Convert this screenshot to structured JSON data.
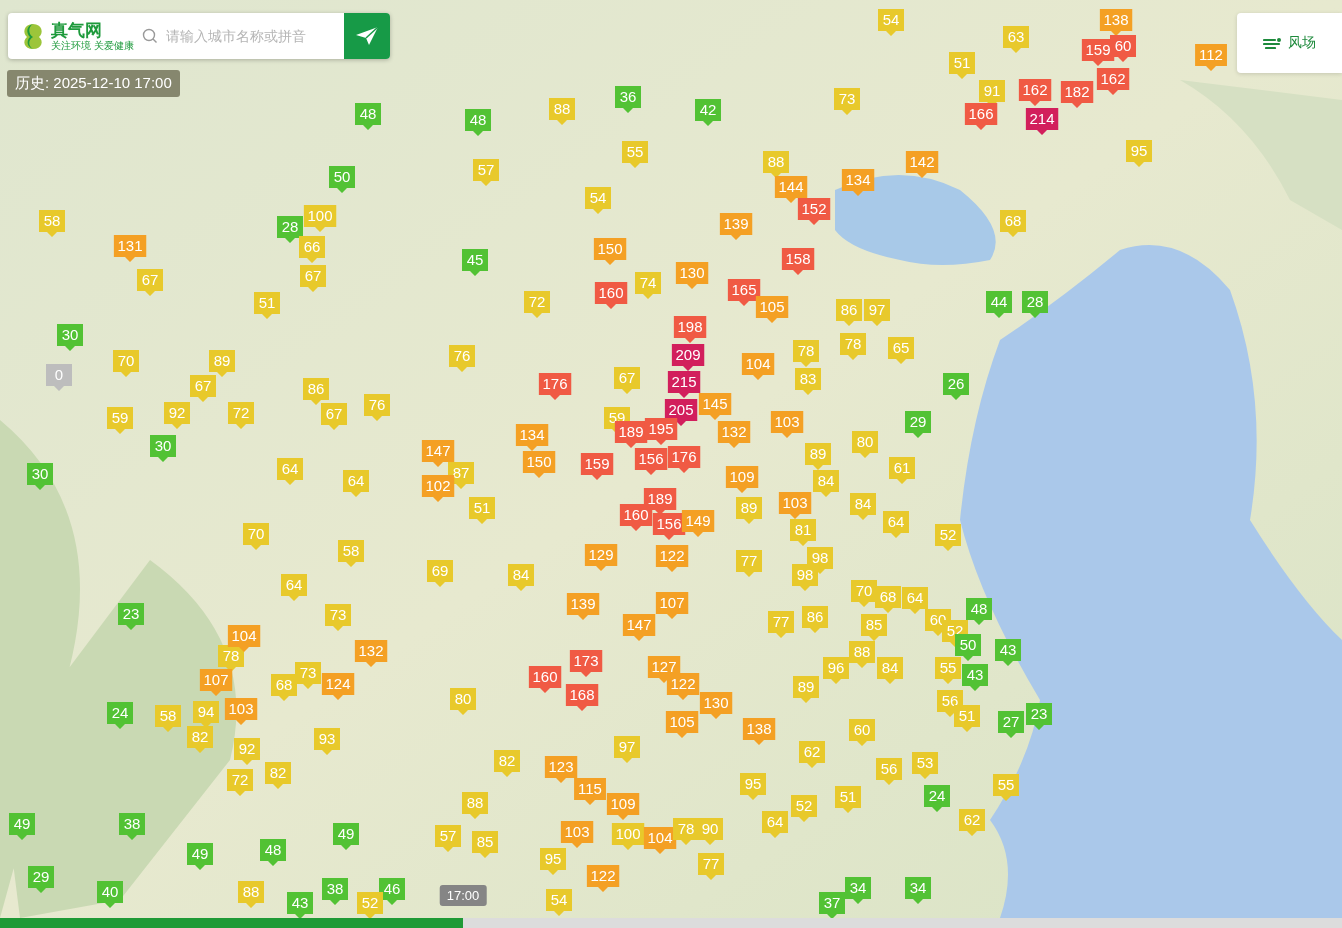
{
  "search": {
    "logo_title": "真气网",
    "logo_tagline": "关注环境 关爱健康",
    "placeholder": "请输入城市名称或拼音"
  },
  "history_badge": "历史: 2025-12-10 17:00",
  "wind_button": "风场",
  "markers": [
    {
      "value": "54",
      "color": "#e8c92b"
    },
    {
      "value": "138",
      "color": "#f4a024"
    },
    {
      "value": "63",
      "color": "#e8c92b"
    },
    {
      "value": "159",
      "color": "#f05a44"
    },
    {
      "value": "60",
      "color": "#f05a44"
    },
    {
      "value": "112",
      "color": "#f4a024"
    },
    {
      "value": "51",
      "color": "#e8c92b"
    },
    {
      "value": "162",
      "color": "#f05a44"
    },
    {
      "value": "48",
      "color": "#52c234"
    },
    {
      "value": "88",
      "color": "#e8c92b"
    },
    {
      "value": "36",
      "color": "#52c234"
    },
    {
      "value": "42",
      "color": "#52c234"
    },
    {
      "value": "73",
      "color": "#e8c92b"
    },
    {
      "value": "91",
      "color": "#e8c92b"
    },
    {
      "value": "166",
      "color": "#f05a44"
    },
    {
      "value": "162",
      "color": "#f05a44"
    },
    {
      "value": "214",
      "color": "#d21f5c"
    },
    {
      "value": "182",
      "color": "#f05a44"
    },
    {
      "value": "48",
      "color": "#52c234"
    },
    {
      "value": "50",
      "color": "#52c234"
    },
    {
      "value": "57",
      "color": "#e8c92b"
    },
    {
      "value": "55",
      "color": "#e8c92b"
    },
    {
      "value": "88",
      "color": "#e8c92b"
    },
    {
      "value": "142",
      "color": "#f4a024"
    },
    {
      "value": "95",
      "color": "#e8c92b"
    },
    {
      "value": "54",
      "color": "#e8c92b"
    },
    {
      "value": "144",
      "color": "#f4a024"
    },
    {
      "value": "152",
      "color": "#f05a44"
    },
    {
      "value": "134",
      "color": "#f4a024"
    },
    {
      "value": "58",
      "color": "#e8c92b"
    },
    {
      "value": "28",
      "color": "#52c234"
    },
    {
      "value": "100",
      "color": "#e8c92b"
    },
    {
      "value": "139",
      "color": "#f4a024"
    },
    {
      "value": "68",
      "color": "#e8c92b"
    },
    {
      "value": "131",
      "color": "#f4a024"
    },
    {
      "value": "66",
      "color": "#e8c92b"
    },
    {
      "value": "45",
      "color": "#52c234"
    },
    {
      "value": "150",
      "color": "#f4a024"
    },
    {
      "value": "158",
      "color": "#f05a44"
    },
    {
      "value": "67",
      "color": "#e8c92b"
    },
    {
      "value": "67",
      "color": "#e8c92b"
    },
    {
      "value": "160",
      "color": "#f05a44"
    },
    {
      "value": "74",
      "color": "#e8c92b"
    },
    {
      "value": "130",
      "color": "#f4a024"
    },
    {
      "value": "165",
      "color": "#f05a44"
    },
    {
      "value": "51",
      "color": "#e8c92b"
    },
    {
      "value": "72",
      "color": "#e8c92b"
    },
    {
      "value": "198",
      "color": "#f05a44"
    },
    {
      "value": "105",
      "color": "#f4a024"
    },
    {
      "value": "86",
      "color": "#e8c92b"
    },
    {
      "value": "97",
      "color": "#e8c92b"
    },
    {
      "value": "44",
      "color": "#52c234"
    },
    {
      "value": "28",
      "color": "#52c234"
    },
    {
      "value": "30",
      "color": "#52c234"
    },
    {
      "value": "76",
      "color": "#e8c92b"
    },
    {
      "value": "209",
      "color": "#d21f5c"
    },
    {
      "value": "78",
      "color": "#e8c92b"
    },
    {
      "value": "78",
      "color": "#e8c92b"
    },
    {
      "value": "65",
      "color": "#e8c92b"
    },
    {
      "value": "0",
      "color": "#bdbdbd"
    },
    {
      "value": "70",
      "color": "#e8c92b"
    },
    {
      "value": "67",
      "color": "#e8c92b"
    },
    {
      "value": "89",
      "color": "#e8c92b"
    },
    {
      "value": "86",
      "color": "#e8c92b"
    },
    {
      "value": "176",
      "color": "#f05a44"
    },
    {
      "value": "67",
      "color": "#e8c92b"
    },
    {
      "value": "215",
      "color": "#d21f5c"
    },
    {
      "value": "104",
      "color": "#f4a024"
    },
    {
      "value": "83",
      "color": "#e8c92b"
    },
    {
      "value": "26",
      "color": "#52c234"
    },
    {
      "value": "59",
      "color": "#e8c92b"
    },
    {
      "value": "92",
      "color": "#e8c92b"
    },
    {
      "value": "72",
      "color": "#e8c92b"
    },
    {
      "value": "67",
      "color": "#e8c92b"
    },
    {
      "value": "76",
      "color": "#e8c92b"
    },
    {
      "value": "59",
      "color": "#e8c92b"
    },
    {
      "value": "205",
      "color": "#d21f5c"
    },
    {
      "value": "145",
      "color": "#f4a024"
    },
    {
      "value": "30",
      "color": "#52c234"
    },
    {
      "value": "134",
      "color": "#f4a024"
    },
    {
      "value": "189",
      "color": "#f05a44"
    },
    {
      "value": "195",
      "color": "#f05a44"
    },
    {
      "value": "132",
      "color": "#f4a024"
    },
    {
      "value": "103",
      "color": "#f4a024"
    },
    {
      "value": "80",
      "color": "#e8c92b"
    },
    {
      "value": "29",
      "color": "#52c234"
    },
    {
      "value": "30",
      "color": "#52c234"
    },
    {
      "value": "64",
      "color": "#e8c92b"
    },
    {
      "value": "147",
      "color": "#f4a024"
    },
    {
      "value": "87",
      "color": "#e8c92b"
    },
    {
      "value": "150",
      "color": "#f4a024"
    },
    {
      "value": "159",
      "color": "#f05a44"
    },
    {
      "value": "156",
      "color": "#f05a44"
    },
    {
      "value": "176",
      "color": "#f05a44"
    },
    {
      "value": "109",
      "color": "#f4a024"
    },
    {
      "value": "89",
      "color": "#e8c92b"
    },
    {
      "value": "61",
      "color": "#e8c92b"
    },
    {
      "value": "64",
      "color": "#e8c92b"
    },
    {
      "value": "102",
      "color": "#f4a024"
    },
    {
      "value": "51",
      "color": "#e8c92b"
    },
    {
      "value": "189",
      "color": "#f05a44"
    },
    {
      "value": "89",
      "color": "#e8c92b"
    },
    {
      "value": "84",
      "color": "#e8c92b"
    },
    {
      "value": "103",
      "color": "#f4a024"
    },
    {
      "value": "84",
      "color": "#e8c92b"
    },
    {
      "value": "70",
      "color": "#e8c92b"
    },
    {
      "value": "160",
      "color": "#f05a44"
    },
    {
      "value": "156",
      "color": "#f05a44"
    },
    {
      "value": "149",
      "color": "#f4a024"
    },
    {
      "value": "81",
      "color": "#e8c92b"
    },
    {
      "value": "64",
      "color": "#e8c92b"
    },
    {
      "value": "52",
      "color": "#e8c92b"
    },
    {
      "value": "58",
      "color": "#e8c92b"
    },
    {
      "value": "129",
      "color": "#f4a024"
    },
    {
      "value": "122",
      "color": "#f4a024"
    },
    {
      "value": "77",
      "color": "#e8c92b"
    },
    {
      "value": "98",
      "color": "#e8c92b"
    },
    {
      "value": "64",
      "color": "#e8c92b"
    },
    {
      "value": "69",
      "color": "#e8c92b"
    },
    {
      "value": "84",
      "color": "#e8c92b"
    },
    {
      "value": "98",
      "color": "#e8c92b"
    },
    {
      "value": "70",
      "color": "#e8c92b"
    },
    {
      "value": "64",
      "color": "#e8c92b"
    },
    {
      "value": "23",
      "color": "#52c234"
    },
    {
      "value": "73",
      "color": "#e8c92b"
    },
    {
      "value": "139",
      "color": "#f4a024"
    },
    {
      "value": "147",
      "color": "#f4a024"
    },
    {
      "value": "107",
      "color": "#f4a024"
    },
    {
      "value": "77",
      "color": "#e8c92b"
    },
    {
      "value": "86",
      "color": "#e8c92b"
    },
    {
      "value": "85",
      "color": "#e8c92b"
    },
    {
      "value": "68",
      "color": "#e8c92b"
    },
    {
      "value": "60",
      "color": "#e8c92b"
    },
    {
      "value": "48",
      "color": "#52c234"
    },
    {
      "value": "78",
      "color": "#e8c92b"
    },
    {
      "value": "104",
      "color": "#f4a024"
    },
    {
      "value": "132",
      "color": "#f4a024"
    },
    {
      "value": "88",
      "color": "#e8c92b"
    },
    {
      "value": "52",
      "color": "#e8c92b"
    },
    {
      "value": "50",
      "color": "#52c234"
    },
    {
      "value": "43",
      "color": "#52c234"
    },
    {
      "value": "107",
      "color": "#f4a024"
    },
    {
      "value": "68",
      "color": "#e8c92b"
    },
    {
      "value": "73",
      "color": "#e8c92b"
    },
    {
      "value": "124",
      "color": "#f4a024"
    },
    {
      "value": "160",
      "color": "#f05a44"
    },
    {
      "value": "173",
      "color": "#f05a44"
    },
    {
      "value": "127",
      "color": "#f4a024"
    },
    {
      "value": "122",
      "color": "#f4a024"
    },
    {
      "value": "89",
      "color": "#e8c92b"
    },
    {
      "value": "96",
      "color": "#e8c92b"
    },
    {
      "value": "84",
      "color": "#e8c92b"
    },
    {
      "value": "55",
      "color": "#e8c92b"
    },
    {
      "value": "43",
      "color": "#52c234"
    },
    {
      "value": "24",
      "color": "#52c234"
    },
    {
      "value": "58",
      "color": "#e8c92b"
    },
    {
      "value": "94",
      "color": "#e8c92b"
    },
    {
      "value": "103",
      "color": "#f4a024"
    },
    {
      "value": "80",
      "color": "#e8c92b"
    },
    {
      "value": "168",
      "color": "#f05a44"
    },
    {
      "value": "130",
      "color": "#f4a024"
    },
    {
      "value": "56",
      "color": "#e8c92b"
    },
    {
      "value": "51",
      "color": "#e8c92b"
    },
    {
      "value": "23",
      "color": "#52c234"
    },
    {
      "value": "82",
      "color": "#e8c92b"
    },
    {
      "value": "92",
      "color": "#e8c92b"
    },
    {
      "value": "93",
      "color": "#e8c92b"
    },
    {
      "value": "97",
      "color": "#e8c92b"
    },
    {
      "value": "105",
      "color": "#f4a024"
    },
    {
      "value": "138",
      "color": "#f4a024"
    },
    {
      "value": "60",
      "color": "#e8c92b"
    },
    {
      "value": "27",
      "color": "#52c234"
    },
    {
      "value": "82",
      "color": "#e8c92b"
    },
    {
      "value": "82",
      "color": "#e8c92b"
    },
    {
      "value": "123",
      "color": "#f4a024"
    },
    {
      "value": "62",
      "color": "#e8c92b"
    },
    {
      "value": "56",
      "color": "#e8c92b"
    },
    {
      "value": "53",
      "color": "#e8c92b"
    },
    {
      "value": "72",
      "color": "#e8c92b"
    },
    {
      "value": "88",
      "color": "#e8c92b"
    },
    {
      "value": "115",
      "color": "#f4a024"
    },
    {
      "value": "109",
      "color": "#f4a024"
    },
    {
      "value": "95",
      "color": "#e8c92b"
    },
    {
      "value": "52",
      "color": "#e8c92b"
    },
    {
      "value": "51",
      "color": "#e8c92b"
    },
    {
      "value": "24",
      "color": "#52c234"
    },
    {
      "value": "55",
      "color": "#e8c92b"
    },
    {
      "value": "49",
      "color": "#52c234"
    },
    {
      "value": "38",
      "color": "#52c234"
    },
    {
      "value": "49",
      "color": "#52c234"
    },
    {
      "value": "57",
      "color": "#e8c92b"
    },
    {
      "value": "103",
      "color": "#f4a024"
    },
    {
      "value": "100",
      "color": "#e8c92b"
    },
    {
      "value": "104",
      "color": "#f4a024"
    },
    {
      "value": "78",
      "color": "#e8c92b"
    },
    {
      "value": "90",
      "color": "#e8c92b"
    },
    {
      "value": "64",
      "color": "#e8c92b"
    },
    {
      "value": "62",
      "color": "#e8c92b"
    },
    {
      "value": "49",
      "color": "#52c234"
    },
    {
      "value": "48",
      "color": "#52c234"
    },
    {
      "value": "85",
      "color": "#e8c92b"
    },
    {
      "value": "95",
      "color": "#e8c92b"
    },
    {
      "value": "77",
      "color": "#e8c92b"
    },
    {
      "value": "29",
      "color": "#52c234"
    },
    {
      "value": "40",
      "color": "#52c234"
    },
    {
      "value": "88",
      "color": "#e8c92b"
    },
    {
      "value": "38",
      "color": "#52c234"
    },
    {
      "value": "46",
      "color": "#52c234"
    },
    {
      "value": "122",
      "color": "#f4a024"
    },
    {
      "value": "34",
      "color": "#52c234"
    },
    {
      "value": "34",
      "color": "#52c234"
    },
    {
      "value": "43",
      "color": "#52c234"
    },
    {
      "value": "52",
      "color": "#e8c92b"
    },
    {
      "value": "54",
      "color": "#e8c92b"
    },
    {
      "value": "37",
      "color": "#52c234"
    }
  ],
  "timeline": {
    "time_label": "17:00",
    "level": 0.345
  }
}
